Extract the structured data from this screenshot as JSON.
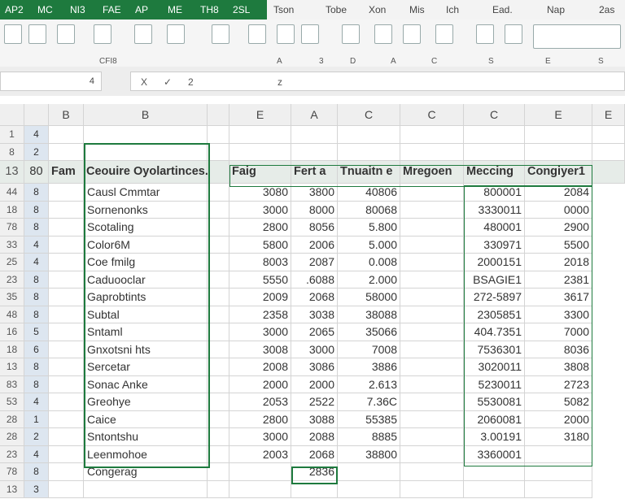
{
  "ribbon_tabs_active": [
    "AP2",
    "MC",
    "NI3",
    "FAE",
    "AP",
    "ME",
    "TH8",
    "2SL"
  ],
  "ribbon_tabs": [
    "Tson",
    "Tobe",
    "Xon",
    "Mis",
    "Ich",
    "Ead.",
    "Nap",
    "2as"
  ],
  "group_labels": [
    "CFI8",
    "A",
    "3",
    "D",
    "A",
    "C",
    "S",
    "E",
    "S"
  ],
  "formula_bar": {
    "name_box": "4",
    "cancel": "X",
    "enter": "✓",
    "fx": "2",
    "value": "z"
  },
  "column_headers": [
    "",
    "",
    "B",
    "B",
    "",
    "E",
    "A",
    "C",
    "C",
    "C",
    "E",
    "E"
  ],
  "top_rows": [
    [
      "1",
      "4"
    ],
    [
      "8",
      "2"
    ]
  ],
  "header_row": {
    "row": [
      "13",
      "80"
    ],
    "cells": [
      "Fam",
      "Ceouire Oyolartinces.",
      "",
      "Faig",
      "Fert a",
      "Tnuaitn e",
      "Mregoen",
      "Meccing",
      "Congiyer1",
      ""
    ]
  },
  "rows": [
    [
      "44",
      "8",
      "",
      "Causl Cmmtar",
      "",
      "3080",
      "3800",
      "40806",
      "",
      "800001",
      "2084"
    ],
    [
      "18",
      "8",
      "",
      "Sornenonks",
      "",
      "3000",
      "8000",
      "80068",
      "",
      "3330011",
      "0000"
    ],
    [
      "78",
      "8",
      "",
      "Scotaling",
      "",
      "2800",
      "8056",
      "5.800",
      "",
      "480001",
      "2900"
    ],
    [
      "33",
      "4",
      "",
      "Color6M",
      "",
      "5800",
      "2006",
      "5.000",
      "",
      "330971",
      "5500"
    ],
    [
      "25",
      "4",
      "",
      "Coe fmilg",
      "",
      "8003",
      "2087",
      "0.008",
      "",
      "2000151",
      "2018"
    ],
    [
      "23",
      "8",
      "",
      "Caduooclar",
      "",
      "5550",
      ".6088",
      "2.000",
      "",
      "BSAGIE1",
      "2381"
    ],
    [
      "35",
      "8",
      "",
      "Gaprobtints",
      "",
      "2009",
      "2068",
      "58000",
      "",
      "272-5897",
      "3617"
    ],
    [
      "48",
      "8",
      "",
      "Subtal",
      "",
      "2358",
      "3038",
      "38088",
      "",
      "2305851",
      "3300"
    ],
    [
      "16",
      "5",
      "",
      "Sntaml",
      "",
      "3000",
      "2065",
      "35066",
      "",
      "404.7351",
      "7000"
    ],
    [
      "18",
      "6",
      "",
      "Gnxotsni hts",
      "",
      "3008",
      "3000",
      "7008",
      "",
      "7536301",
      "8036"
    ],
    [
      "13",
      "8",
      "",
      "Sercetar",
      "",
      "2008",
      "3086",
      "3886",
      "",
      "3020011",
      "3808"
    ],
    [
      "83",
      "8",
      "",
      "Sonac Anke",
      "",
      "2000",
      "2000",
      "2.613",
      "",
      "5230011",
      "2723"
    ],
    [
      "53",
      "4",
      "",
      "Greohye",
      "",
      "2053",
      "2522",
      "7.36C",
      "",
      "5530081",
      "5082"
    ],
    [
      "28",
      "1",
      "",
      "Caice",
      "",
      "2800",
      "3088",
      "55385",
      "",
      "2060081",
      "2000"
    ],
    [
      "28",
      "2",
      "",
      "Sntontshu",
      "",
      "3000",
      "2088",
      "8885",
      "",
      "3.00191",
      "3180"
    ],
    [
      "23",
      "4",
      "",
      "Leenmohoe",
      "",
      "2003",
      "2068",
      "38800",
      "",
      "3360001",
      ""
    ],
    [
      "78",
      "8",
      "",
      "Congerag",
      "",
      "",
      "2836",
      "",
      "",
      "",
      ""
    ],
    [
      "13",
      "3",
      "",
      "",
      "",
      "",
      "",
      "",
      "",
      "",
      ""
    ]
  ],
  "accent": "#1e7a3e"
}
